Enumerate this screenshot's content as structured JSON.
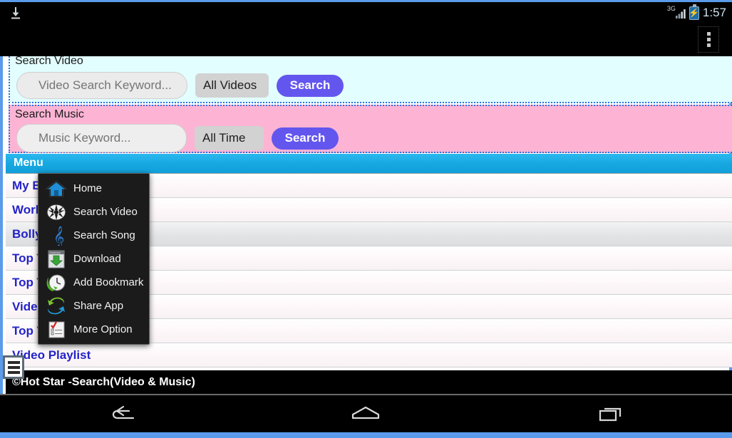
{
  "status_bar": {
    "download_icon": "download-arrow-icon",
    "network_label": "3G",
    "signal_icon": "signal-bars-icon",
    "battery_icon": "battery-charging-icon",
    "clock": "1:57"
  },
  "action_bar": {
    "overflow_icon": "overflow-menu-icon"
  },
  "video_search": {
    "legend": "Search Video",
    "input_placeholder": "Video Search Keyword...",
    "input_value": "",
    "filter_value": "All Videos",
    "filter_options": [
      "All Videos"
    ],
    "button_label": "Search",
    "bg_color": "#e2feff",
    "border_color": "#2f6fe0"
  },
  "music_search": {
    "legend": "Search Music",
    "input_placeholder": "Music Keyword...",
    "input_value": "",
    "filter_value": "All Time",
    "filter_options": [
      "All Time"
    ],
    "button_label": "Search",
    "bg_color": "#fdb4d4",
    "border_color": "#2f6fe0"
  },
  "menu_bar": {
    "title": "Menu",
    "bg_color": "#16a6e0"
  },
  "list": {
    "link_color": "#2323c8",
    "items": [
      {
        "label": "My Bookmark",
        "selected": false
      },
      {
        "label": "World Top Song",
        "selected": false
      },
      {
        "label": "Bollywood Top Song",
        "selected": true
      },
      {
        "label": "Top Ten Song",
        "selected": false
      },
      {
        "label": "Top Ten Video",
        "selected": false
      },
      {
        "label": "Video Songs",
        "selected": false
      },
      {
        "label": "Top Video",
        "selected": false
      },
      {
        "label": "Video Playlist",
        "selected": false
      }
    ]
  },
  "footer": {
    "text": "©Hot Star -Search(Video & Music)"
  },
  "fab": {
    "icon": "hamburger-menu-icon"
  },
  "popup_menu": {
    "bg_color": "#1b1b1b",
    "items": [
      {
        "label": "Home",
        "icon": "home-icon"
      },
      {
        "label": "Search Video",
        "icon": "film-reel-icon"
      },
      {
        "label": "Search Song",
        "icon": "music-clef-icon"
      },
      {
        "label": "Download",
        "icon": "download-icon"
      },
      {
        "label": "Add Bookmark",
        "icon": "clock-bookmark-icon"
      },
      {
        "label": "Share App",
        "icon": "share-arrows-icon"
      },
      {
        "label": "More Option",
        "icon": "checklist-icon"
      }
    ]
  },
  "nav_bar": {
    "back_icon": "back-arrow-icon",
    "home_icon": "home-outline-icon",
    "recents_icon": "recent-apps-icon"
  }
}
